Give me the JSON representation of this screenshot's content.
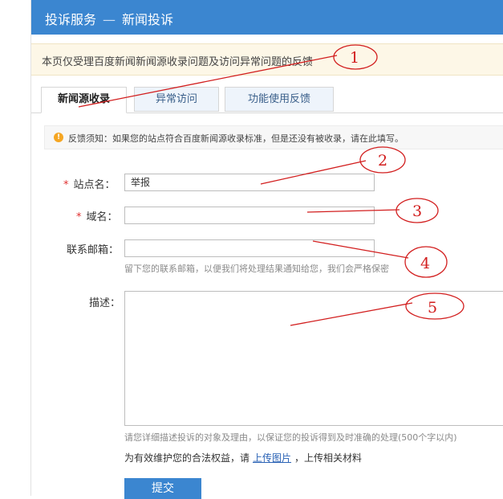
{
  "header": {
    "service": "投诉服务",
    "separator": "—",
    "section": "新闻投诉"
  },
  "notice": "本页仅受理百度新闻新闻源收录问题及访问异常问题的反馈",
  "tabs": [
    {
      "label": "新闻源收录",
      "active": true
    },
    {
      "label": "异常访问",
      "active": false
    },
    {
      "label": "功能使用反馈",
      "active": false
    }
  ],
  "tip": "反馈须知：如果您的站点符合百度新闻源收录标准，但是还没有被收录，请在此填写。",
  "form": {
    "required_mark": "*",
    "site_name_label": "站点名：",
    "site_name_value": "举报",
    "domain_label": "域名：",
    "domain_value": "",
    "email_label": "联系邮箱：",
    "email_value": "",
    "email_hint": "留下您的联系邮箱，以便我们将处理结果通知给您，我们会严格保密",
    "desc_label": "描述：",
    "desc_value": "",
    "desc_hint": "请您详细描述投诉的对象及理由，以保证您的投诉得到及时准确的处理(500个字以内)",
    "rights_prefix": "为有效维护您的合法权益，请",
    "upload_link": "上传图片",
    "rights_suffix": "，上传相关材料",
    "submit_label": "提交"
  },
  "annotations": [
    "1",
    "2",
    "3",
    "4",
    "5"
  ],
  "colors": {
    "header_bg": "#3b86d0",
    "annotation": "#d21e1e",
    "required": "#e03030",
    "link": "#2a62b5"
  }
}
